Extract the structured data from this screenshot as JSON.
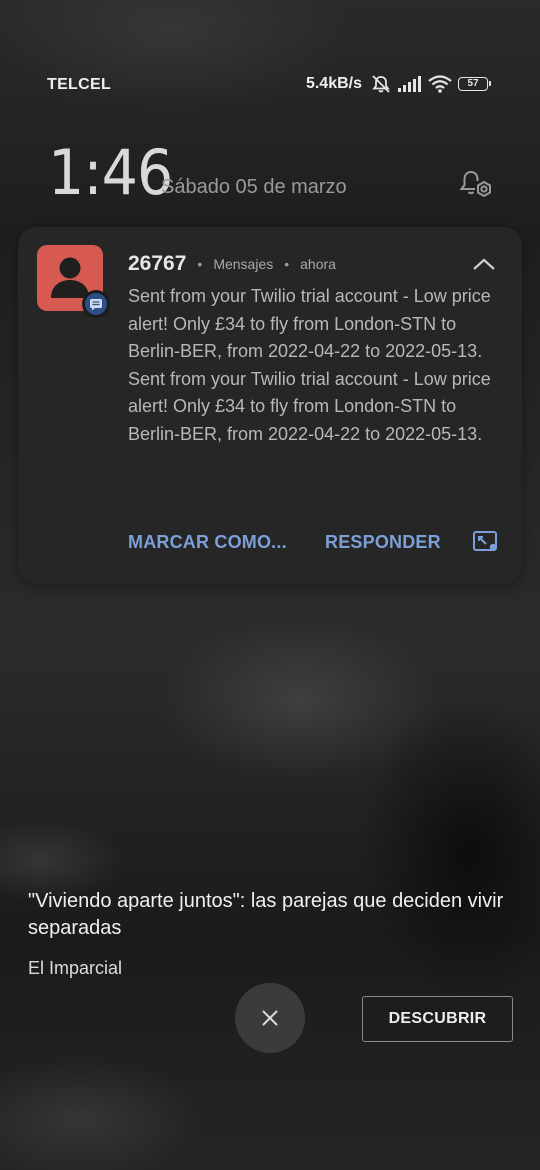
{
  "status_bar": {
    "carrier": "TELCEL",
    "network_speed": "5.4kB/s",
    "battery_level": "57",
    "icons": [
      "mute-vibrate-icon",
      "signal-icon",
      "wifi-icon",
      "battery-icon"
    ]
  },
  "lockscreen": {
    "time": "1:46",
    "date": "Sábado 05 de marzo",
    "notification_settings_icon": "bell-gear-icon"
  },
  "notification": {
    "sender": "26767",
    "app_name": "Mensajes",
    "time": "ahora",
    "avatar_color": "#d65a52",
    "messages": [
      "Sent from your Twilio trial account - Low price alert! Only £34 to fly from London-STN to Berlin-BER, from 2022-04-22 to 2022-05-13.",
      "Sent from your Twilio trial account - Low price alert! Only £34 to fly from London-STN to Berlin-BER, from 2022-04-22 to 2022-05-13."
    ],
    "actions": {
      "mark_as_read": "MARCAR COMO...",
      "reply": "RESPONDER"
    },
    "accent_color": "#7c9fd8"
  },
  "news": {
    "headline": "\"Viviendo aparte juntos\": las parejas que deciden vivir separadas",
    "source": "El Imparcial",
    "discover_label": "DESCUBRIR"
  }
}
